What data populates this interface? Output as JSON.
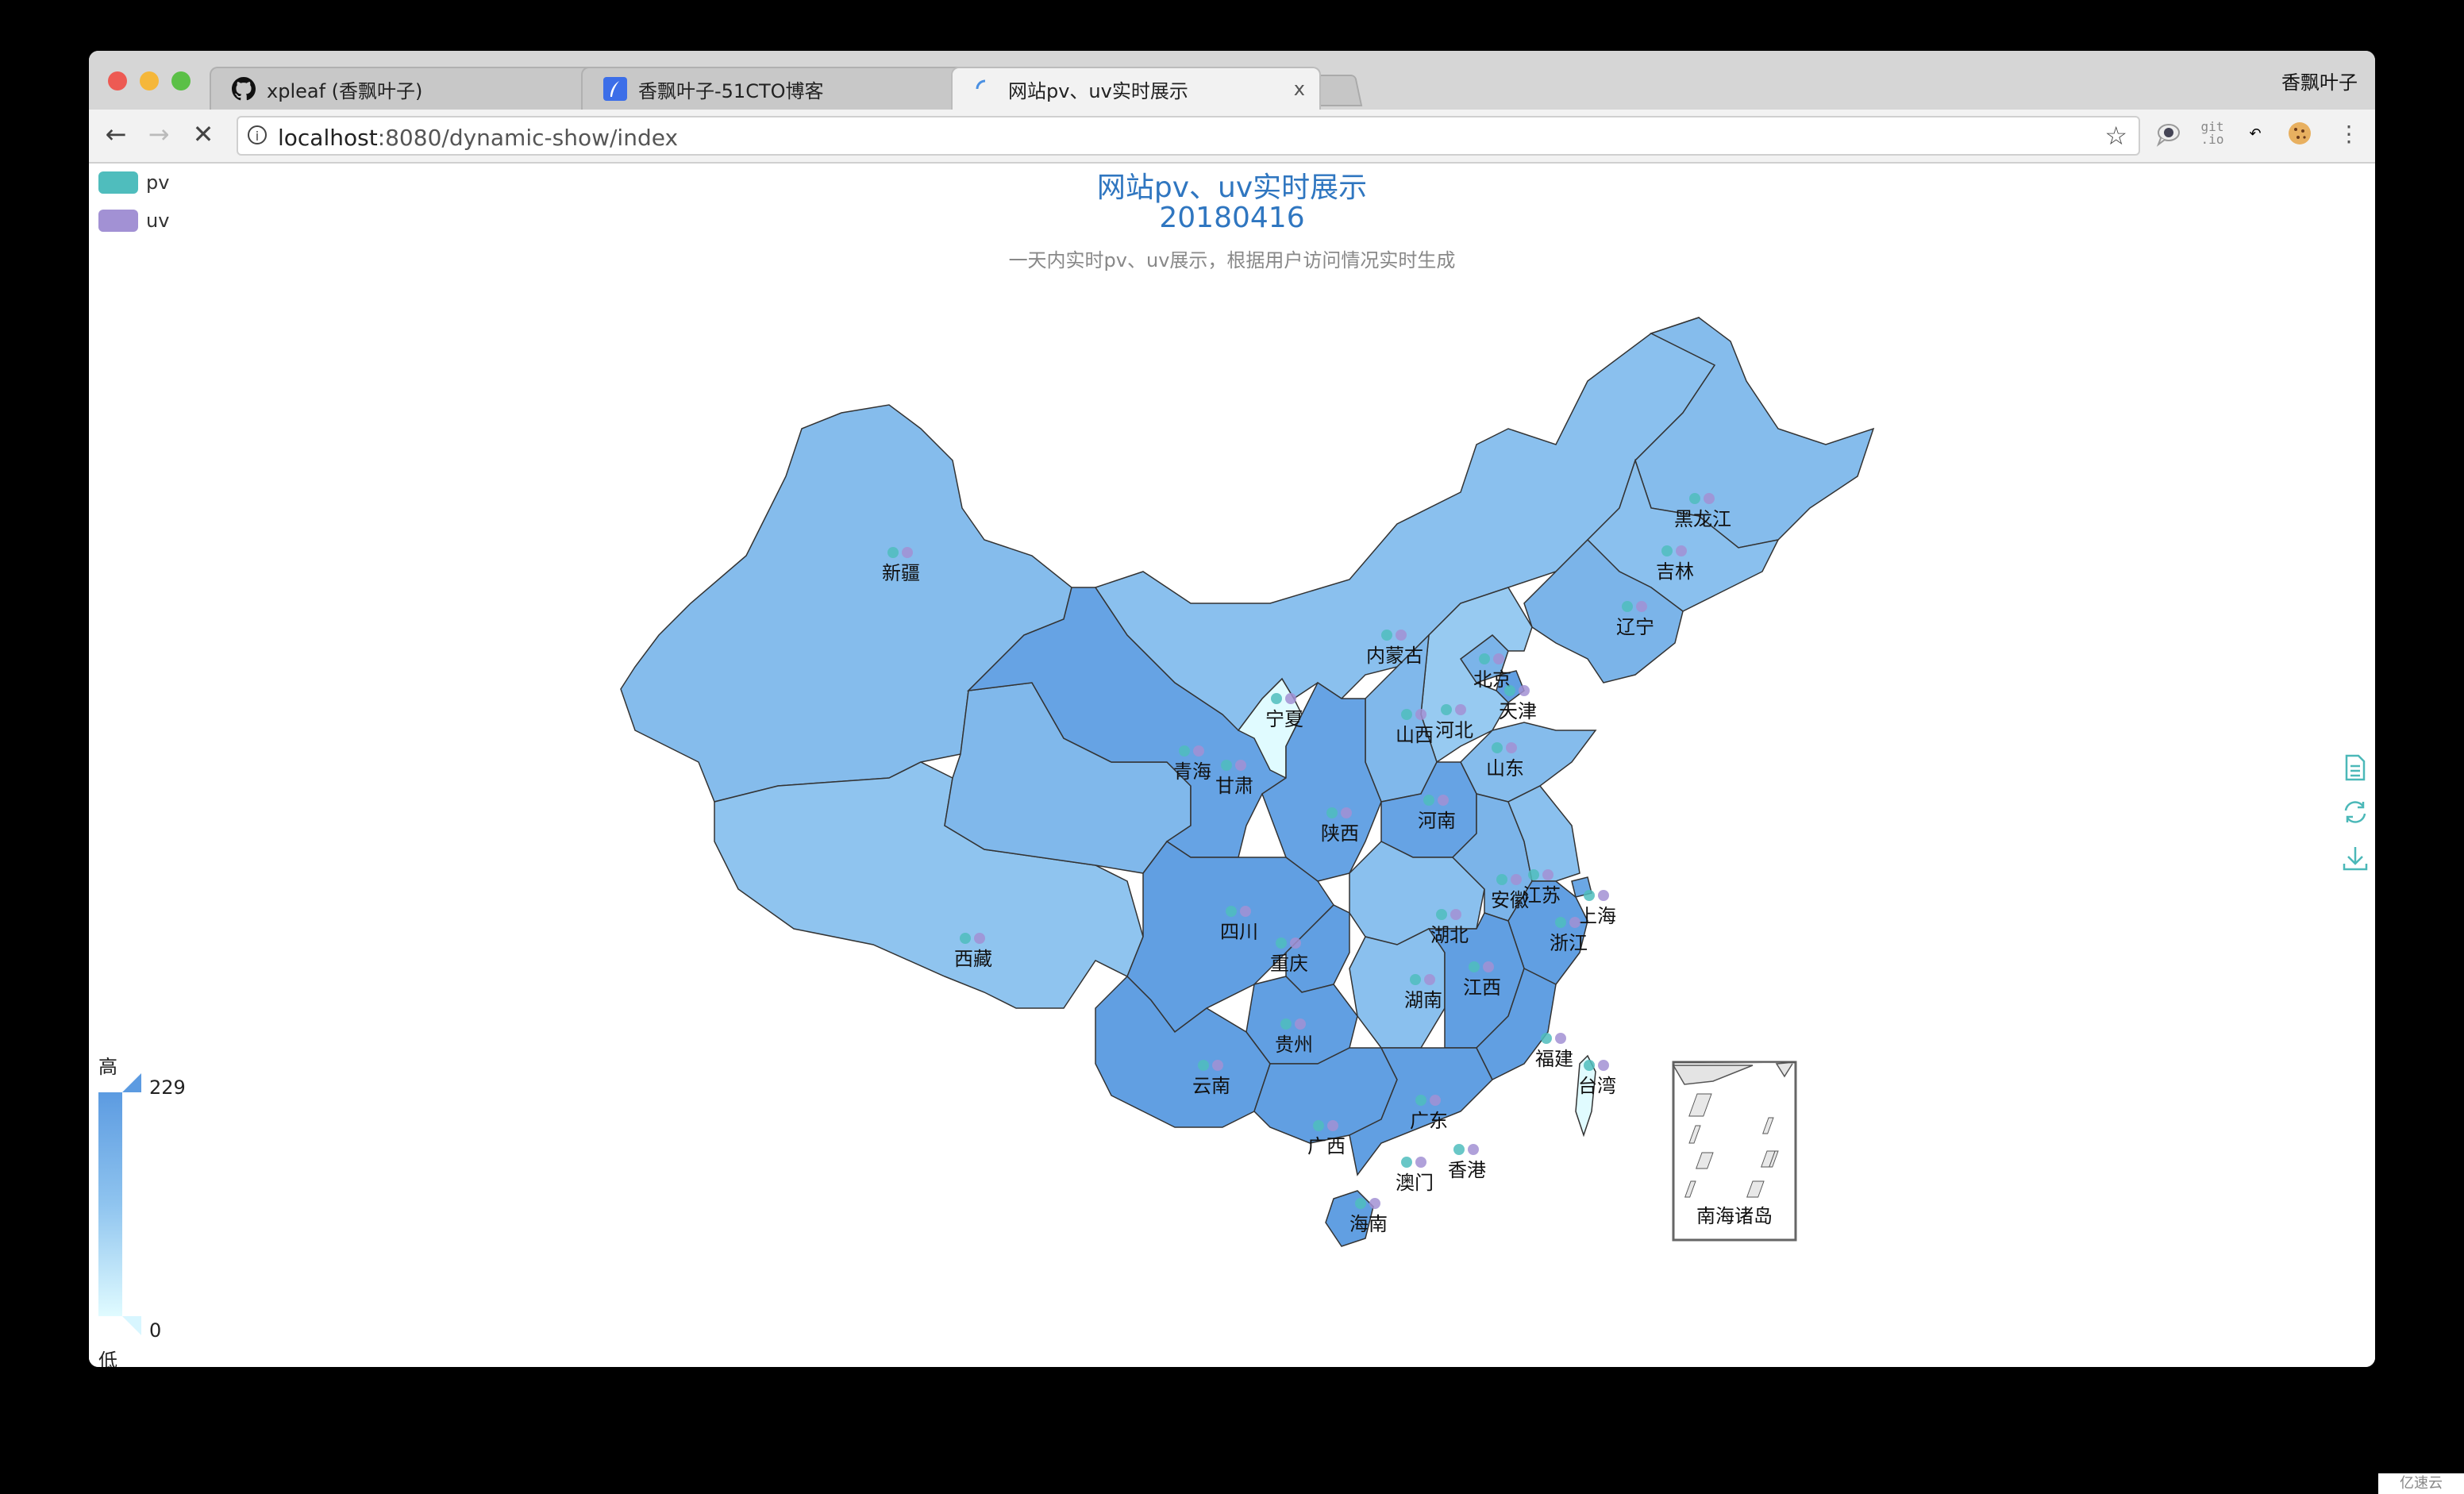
{
  "browser": {
    "tabs": [
      {
        "label": "xpleaf (香飘叶子)",
        "icon": "github-icon",
        "active": false
      },
      {
        "label": "香飘叶子-51CTO博客",
        "icon": "feather-icon",
        "active": false
      },
      {
        "label": "网站pv、uv实时展示",
        "icon": "loading-spinner-icon",
        "active": true
      }
    ],
    "close_glyph": "x",
    "profile_name": "香飘叶子",
    "url_host": "localhost",
    "url_rest": ":8080/dynamic-show/index",
    "extensions": [
      "speech-bubble-icon",
      "git-io-icon",
      "translate-icon",
      "cookie-icon"
    ]
  },
  "legend": [
    {
      "label": "pv",
      "color": "#4fbdbd"
    },
    {
      "label": "uv",
      "color": "#a291d4"
    }
  ],
  "toolbox": [
    "data-view-icon",
    "restore-icon",
    "save-image-icon"
  ],
  "watermark": "亿速云",
  "chart_data": {
    "type": "map",
    "title": "网站pv、uv实时展示",
    "title_line2": "20180416",
    "subtitle": "一天内实时pv、uv展示，根据用户访问情况实时生成",
    "series": [
      {
        "name": "pv",
        "color": "#4fbdbd"
      },
      {
        "name": "uv",
        "color": "#a291d4"
      }
    ],
    "visual_map": {
      "min": 0,
      "max": 229,
      "text_high": "高",
      "text_low": "低",
      "color_low": "#e0fbff",
      "color_high": "#5c9be1"
    },
    "inset_label": "南海诸岛",
    "regions": [
      {
        "name": "新疆",
        "level": 0.6
      },
      {
        "name": "西藏",
        "level": 0.5
      },
      {
        "name": "青海",
        "level": 0.65
      },
      {
        "name": "甘肃",
        "level": 0.9
      },
      {
        "name": "宁夏",
        "level": 0.0
      },
      {
        "name": "内蒙古",
        "level": 0.55
      },
      {
        "name": "黑龙江",
        "level": 0.6
      },
      {
        "name": "吉林",
        "level": 0.55
      },
      {
        "name": "辽宁",
        "level": 0.7
      },
      {
        "name": "北京",
        "level": 0.7
      },
      {
        "name": "天津",
        "level": 0.95
      },
      {
        "name": "河北",
        "level": 0.45
      },
      {
        "name": "山西",
        "level": 0.65
      },
      {
        "name": "山东",
        "level": 0.6
      },
      {
        "name": "陕西",
        "level": 0.9
      },
      {
        "name": "河南",
        "level": 0.9
      },
      {
        "name": "四川",
        "level": 0.95
      },
      {
        "name": "重庆",
        "level": 0.95
      },
      {
        "name": "湖北",
        "level": 0.55
      },
      {
        "name": "安徽",
        "level": 0.7
      },
      {
        "name": "江苏",
        "level": 0.55
      },
      {
        "name": "上海",
        "level": 0.85
      },
      {
        "name": "浙江",
        "level": 0.95
      },
      {
        "name": "湖南",
        "level": 0.55
      },
      {
        "name": "江西",
        "level": 0.95
      },
      {
        "name": "贵州",
        "level": 0.95
      },
      {
        "name": "云南",
        "level": 0.95
      },
      {
        "name": "广西",
        "level": 0.95
      },
      {
        "name": "广东",
        "level": 0.95
      },
      {
        "name": "福建",
        "level": 0.95
      },
      {
        "name": "台湾",
        "level": 0.0
      },
      {
        "name": "海南",
        "level": 0.95
      },
      {
        "name": "香港",
        "level": null
      },
      {
        "name": "澳门",
        "level": null
      }
    ]
  }
}
